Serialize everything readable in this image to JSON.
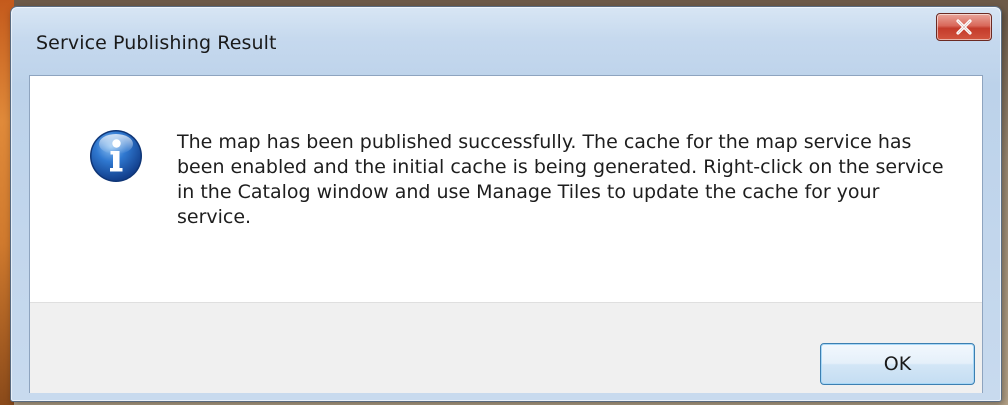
{
  "window": {
    "title": "Service Publishing Result"
  },
  "dialog": {
    "icon": "info-icon",
    "message": "The map has been published successfully. The cache for the map service has been enabled and the initial cache is being generated. Right-click on the service in the Catalog window and use Manage Tiles to update the cache for your service.",
    "ok_label": "OK"
  },
  "colors": {
    "close_button": "#c43b2b",
    "info_icon": "#1d5fb8",
    "ok_button_border": "#3c7fb1",
    "footer_background": "#f0f0f0"
  }
}
